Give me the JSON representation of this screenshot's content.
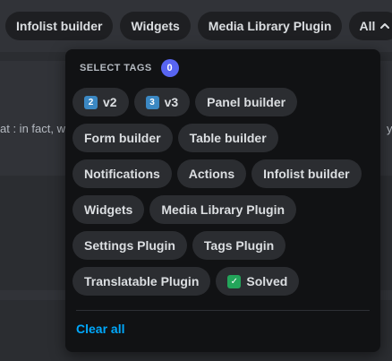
{
  "topbar": {
    "chips": [
      "Infolist builder",
      "Widgets",
      "Media Library Plugin"
    ],
    "all_label": "All"
  },
  "background": {
    "left_text": "at : in fact, w",
    "right_text": "y n"
  },
  "popup": {
    "title": "SELECT TAGS",
    "count": "0",
    "tags": [
      {
        "label": "v2",
        "emoji": "2",
        "emoji_color": "#3b88c3"
      },
      {
        "label": "v3",
        "emoji": "3",
        "emoji_color": "#3b88c3"
      },
      {
        "label": "Panel builder"
      },
      {
        "label": "Form builder"
      },
      {
        "label": "Table builder"
      },
      {
        "label": "Notifications"
      },
      {
        "label": "Actions"
      },
      {
        "label": "Infolist builder"
      },
      {
        "label": "Widgets"
      },
      {
        "label": "Media Library Plugin"
      },
      {
        "label": "Settings Plugin"
      },
      {
        "label": "Tags Plugin"
      },
      {
        "label": "Translatable Plugin"
      },
      {
        "label": "Solved",
        "emoji": "✓",
        "emoji_color": "#23a55a"
      }
    ],
    "clear_all_label": "Clear all"
  },
  "colors": {
    "accent": "#5865f2",
    "link": "#00a8fc",
    "popup_bg": "#111214"
  }
}
